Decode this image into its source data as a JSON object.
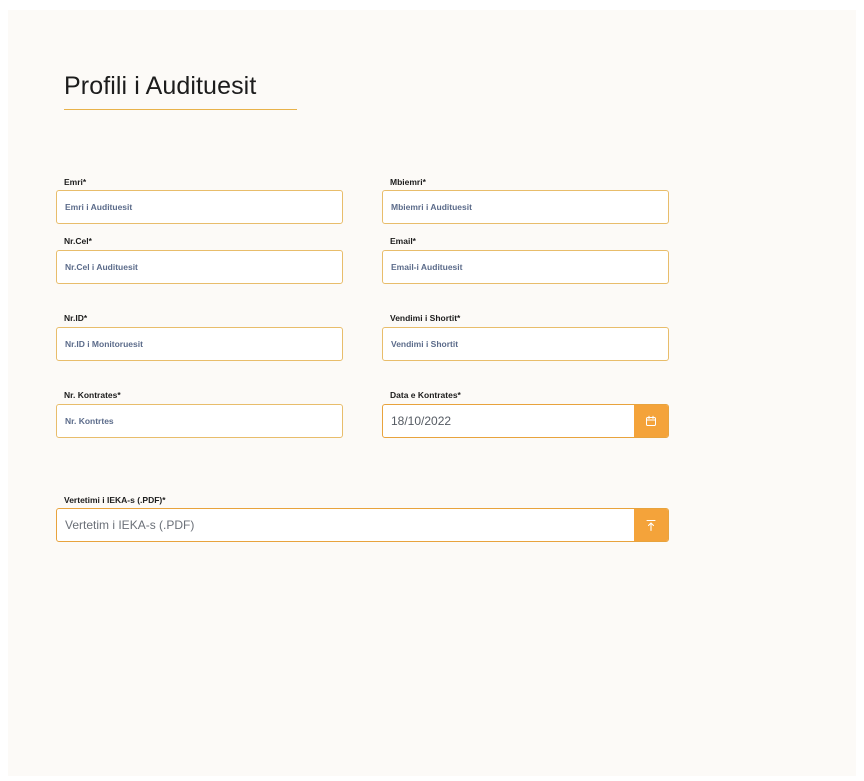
{
  "page": {
    "title": "Profili i Audituesit"
  },
  "form": {
    "emri": {
      "label": "Emri*",
      "placeholder": "Emri i Audituesit"
    },
    "mbiemri": {
      "label": "Mbiemri*",
      "placeholder": "Mbiemri i Audituesit"
    },
    "nrcel": {
      "label": "Nr.Cel*",
      "placeholder": "Nr.Cel i Audituesit"
    },
    "email": {
      "label": "Email*",
      "placeholder": "Email-i Audituesit"
    },
    "nrid": {
      "label": "Nr.ID*",
      "placeholder": "Nr.ID i Monitoruesit"
    },
    "vendimi": {
      "label": "Vendimi i Shortit*",
      "placeholder": "Vendimi i Shortit"
    },
    "kontrates": {
      "label": "Nr. Kontrates*",
      "placeholder": "Nr. Kontrtes"
    },
    "data": {
      "label": "Data e Kontrates*",
      "value": "18/10/2022",
      "icon": "calendar-icon"
    },
    "vertetimi": {
      "label": "Vertetimi i IEKA-s (.PDF)*",
      "placeholder": "Vertetim i IEKA-s (.PDF)",
      "icon": "upload-icon"
    }
  },
  "colors": {
    "accent": "#f4a33a",
    "input_border": "#e8bd6b",
    "background": "#fcfaf7"
  }
}
